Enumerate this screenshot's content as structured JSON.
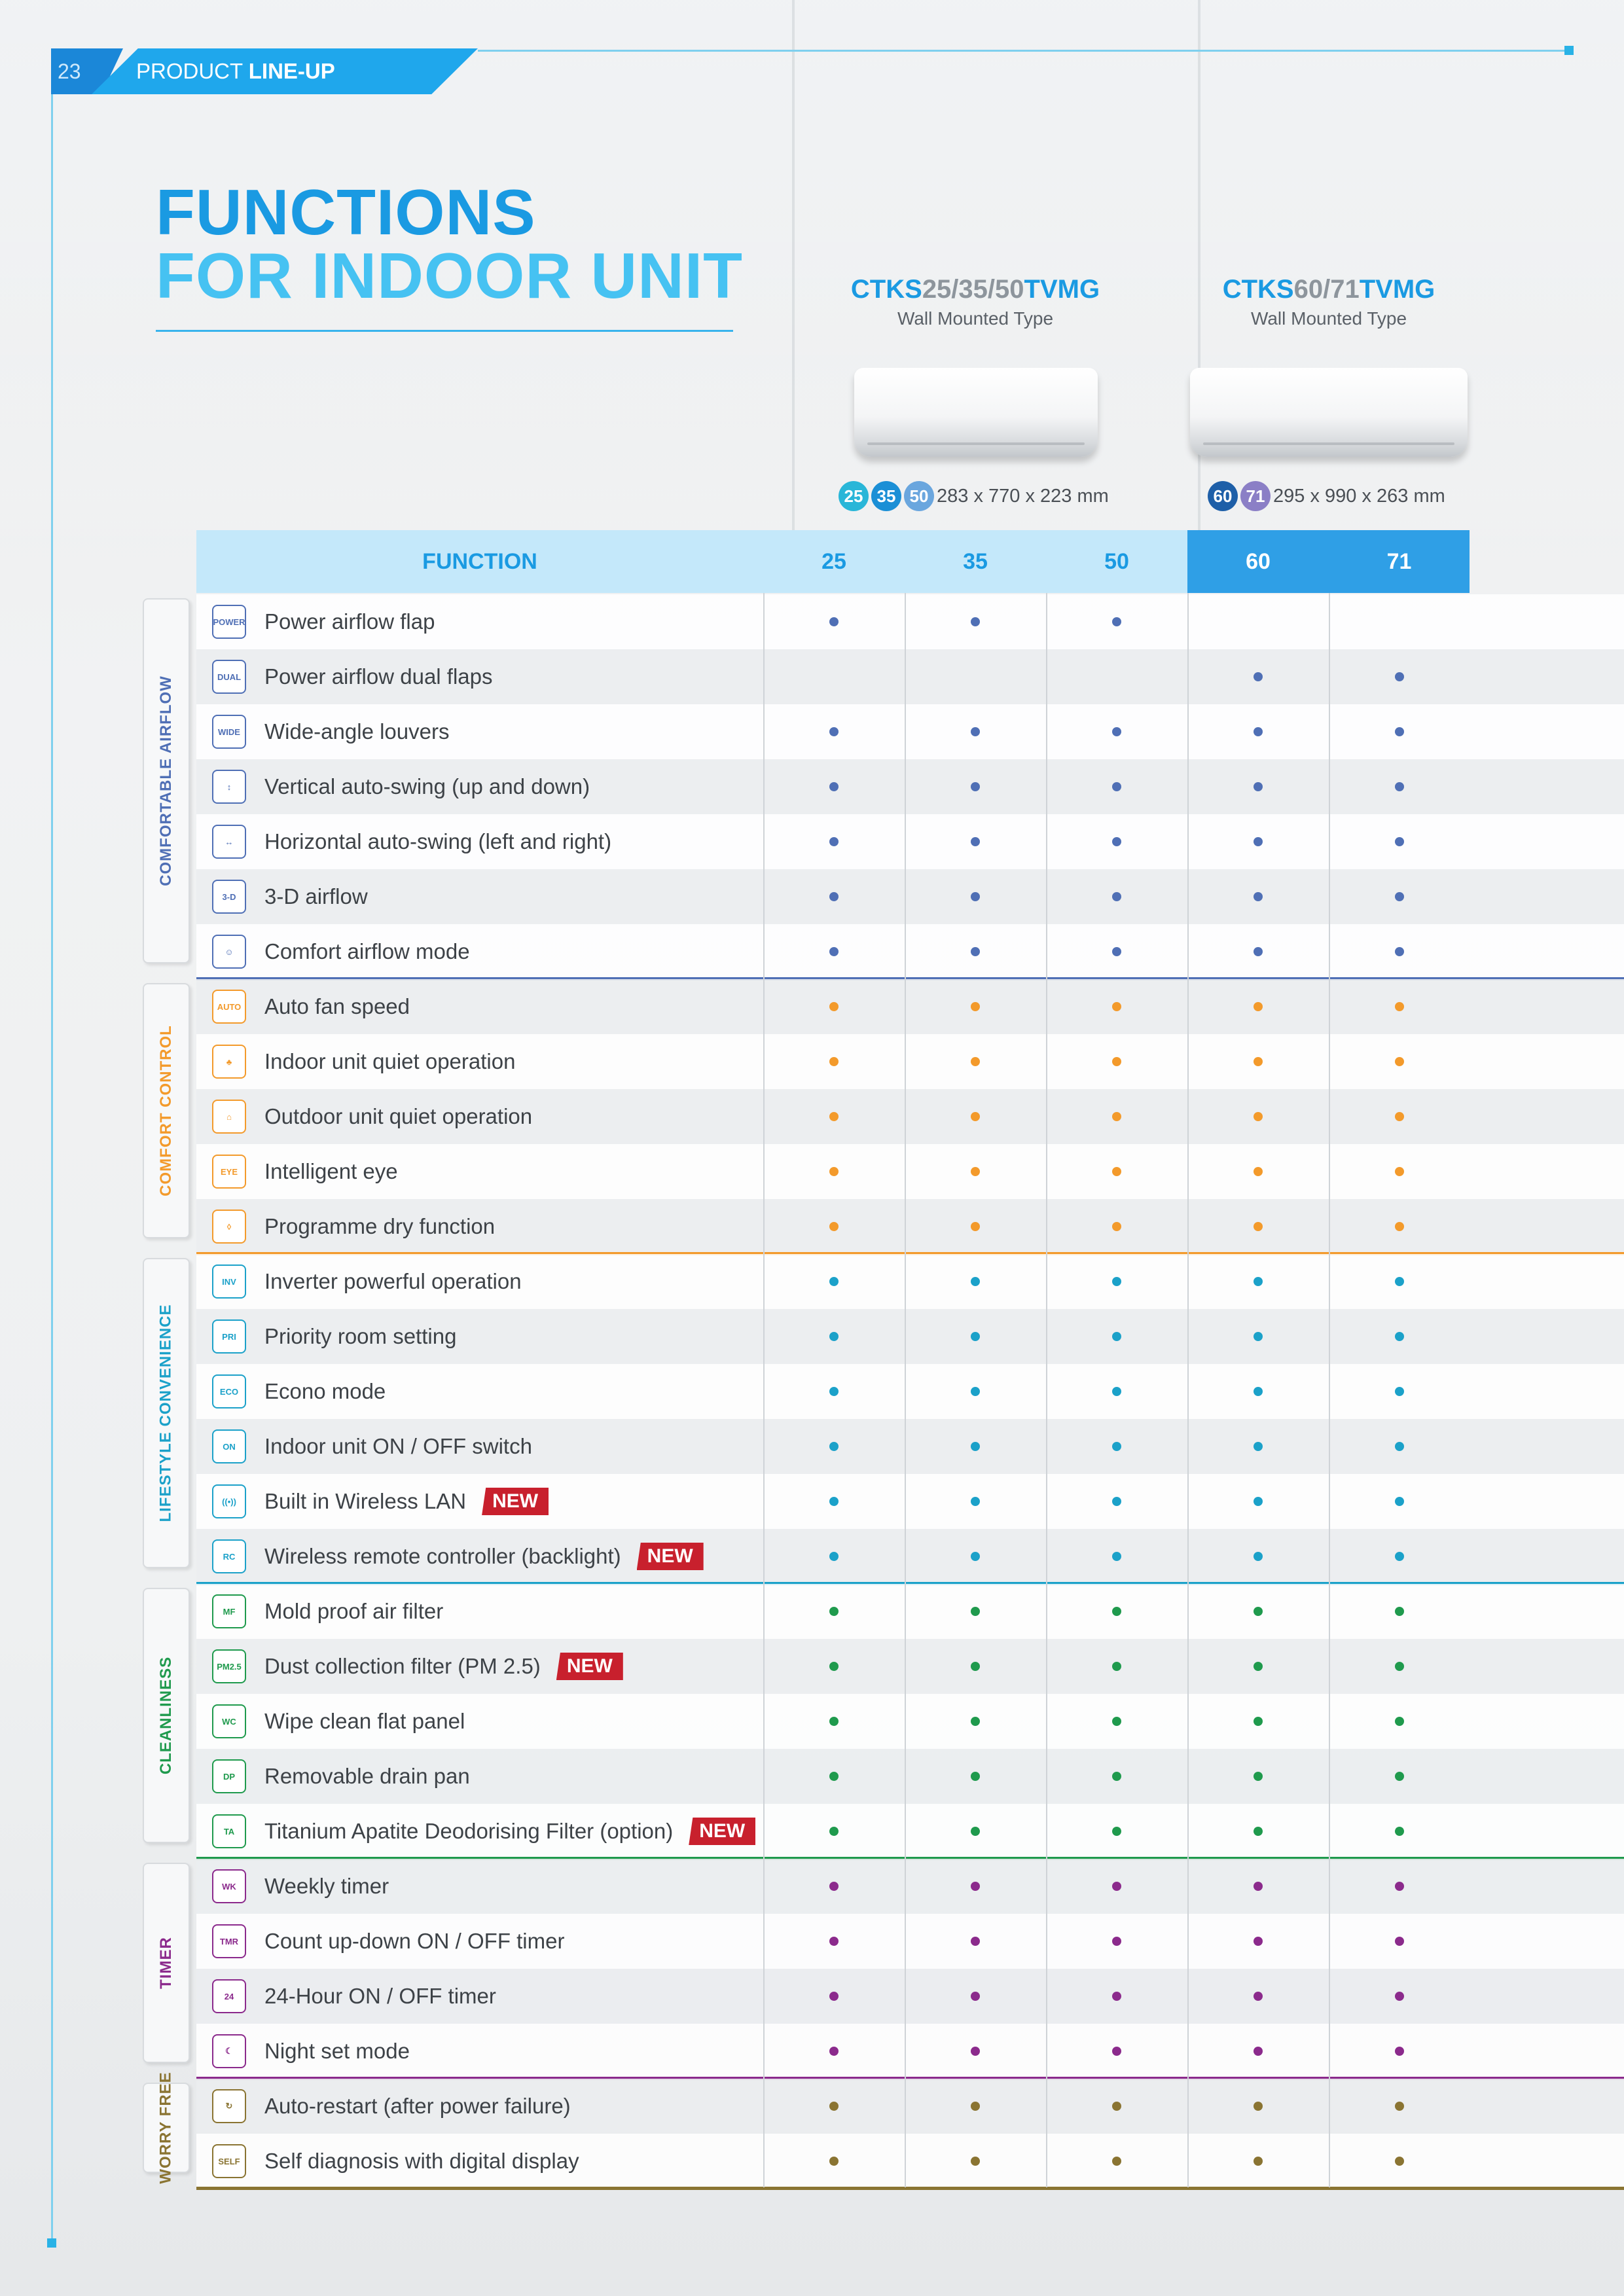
{
  "header": {
    "page_number": "23",
    "section_plain": "PRODUCT ",
    "section_bold": "LINE-UP"
  },
  "title": {
    "line1": "FUNCTIONS",
    "line2": "FOR INDOOR UNIT"
  },
  "models": [
    {
      "prefix": "CTKS",
      "sizes": "25/35/50",
      "suffix": "TVMG",
      "type": "Wall Mounted Type",
      "capacities": [
        "25",
        "35",
        "50"
      ],
      "capacity_colors": [
        "#29b6d8",
        "#1b8fd6",
        "#6aa6de"
      ],
      "dimensions": "283 x 770 x 223 mm"
    },
    {
      "prefix": "CTKS",
      "sizes": "60/71",
      "suffix": "TVMG",
      "type": "Wall Mounted Type",
      "capacities": [
        "60",
        "71"
      ],
      "capacity_colors": [
        "#1e5fa8",
        "#8b7fc6"
      ],
      "dimensions": "295 x 990 x 263 mm"
    }
  ],
  "table": {
    "function_header": "FUNCTION",
    "columns": [
      "25",
      "35",
      "50",
      "60",
      "71"
    ],
    "new_label": "NEW",
    "categories": [
      {
        "name": "COMFORTABLE AIRFLOW",
        "color": "#4f6fb5",
        "rows": [
          {
            "label": "Power airflow flap",
            "icon": "POWER",
            "dots": [
              true,
              true,
              true,
              false,
              false
            ]
          },
          {
            "label": "Power airflow dual flaps",
            "icon": "DUAL",
            "dots": [
              false,
              false,
              false,
              true,
              true
            ]
          },
          {
            "label": "Wide-angle louvers",
            "icon": "WIDE",
            "dots": [
              true,
              true,
              true,
              true,
              true
            ]
          },
          {
            "label": "Vertical auto-swing (up and down)",
            "icon": "↕",
            "dots": [
              true,
              true,
              true,
              true,
              true
            ]
          },
          {
            "label": "Horizontal auto-swing (left and right)",
            "icon": "↔",
            "dots": [
              true,
              true,
              true,
              true,
              true
            ]
          },
          {
            "label": "3-D airflow",
            "icon": "3-D",
            "dots": [
              true,
              true,
              true,
              true,
              true
            ]
          },
          {
            "label": "Comfort airflow mode",
            "icon": "☺",
            "dots": [
              true,
              true,
              true,
              true,
              true
            ]
          }
        ]
      },
      {
        "name": "COMFORT CONTROL",
        "color": "#f39a2b",
        "rows": [
          {
            "label": "Auto fan speed",
            "icon": "AUTO",
            "dots": [
              true,
              true,
              true,
              true,
              true
            ]
          },
          {
            "label": "Indoor unit quiet operation",
            "icon": "♣",
            "dots": [
              true,
              true,
              true,
              true,
              true
            ]
          },
          {
            "label": "Outdoor unit quiet operation",
            "icon": "⌂",
            "dots": [
              true,
              true,
              true,
              true,
              true
            ]
          },
          {
            "label": "Intelligent eye",
            "icon": "EYE",
            "dots": [
              true,
              true,
              true,
              true,
              true
            ]
          },
          {
            "label": "Programme dry function",
            "icon": "◊",
            "dots": [
              true,
              true,
              true,
              true,
              true
            ]
          }
        ]
      },
      {
        "name": "LIFESTYLE CONVENIENCE",
        "color": "#1ba1c9",
        "rows": [
          {
            "label": "Inverter powerful operation",
            "icon": "INV",
            "dots": [
              true,
              true,
              true,
              true,
              true
            ]
          },
          {
            "label": "Priority room setting",
            "icon": "PRI",
            "dots": [
              true,
              true,
              true,
              true,
              true
            ]
          },
          {
            "label": "Econo mode",
            "icon": "ECO",
            "dots": [
              true,
              true,
              true,
              true,
              true
            ]
          },
          {
            "label": "Indoor unit ON / OFF switch",
            "icon": "ON",
            "dots": [
              true,
              true,
              true,
              true,
              true
            ]
          },
          {
            "label": "Built in Wireless LAN",
            "icon": "((•))",
            "new": true,
            "dots": [
              true,
              true,
              true,
              true,
              true
            ]
          },
          {
            "label": "Wireless remote controller (backlight)",
            "icon": "RC",
            "new": true,
            "dots": [
              true,
              true,
              true,
              true,
              true
            ]
          }
        ]
      },
      {
        "name": "CLEANLINESS",
        "color": "#1f9a4d",
        "rows": [
          {
            "label": "Mold proof air filter",
            "icon": "MF",
            "dots": [
              true,
              true,
              true,
              true,
              true
            ]
          },
          {
            "label": "Dust collection filter (PM 2.5)",
            "icon": "PM2.5",
            "new": true,
            "dots": [
              true,
              true,
              true,
              true,
              true
            ]
          },
          {
            "label": "Wipe clean flat panel",
            "icon": "WC",
            "dots": [
              true,
              true,
              true,
              true,
              true
            ]
          },
          {
            "label": "Removable drain pan",
            "icon": "DP",
            "dots": [
              true,
              true,
              true,
              true,
              true
            ]
          },
          {
            "label": "Titanium Apatite Deodorising  Filter (option)",
            "icon": "TA",
            "new": true,
            "dots": [
              true,
              true,
              true,
              true,
              true
            ]
          }
        ]
      },
      {
        "name": "TIMER",
        "color": "#8b2a8c",
        "rows": [
          {
            "label": "Weekly timer",
            "icon": "WK",
            "dots": [
              true,
              true,
              true,
              true,
              true
            ]
          },
          {
            "label": "Count up-down ON / OFF timer",
            "icon": "TMR",
            "dots": [
              true,
              true,
              true,
              true,
              true
            ]
          },
          {
            "label": "24-Hour ON / OFF timer",
            "icon": "24",
            "dots": [
              true,
              true,
              true,
              true,
              true
            ]
          },
          {
            "label": "Night set mode",
            "icon": "☾",
            "dots": [
              true,
              true,
              true,
              true,
              true
            ]
          }
        ]
      },
      {
        "name": "WORRY FREE",
        "color": "#8a7432",
        "rows": [
          {
            "label": "Auto-restart (after power failure)",
            "icon": "↻",
            "dots": [
              true,
              true,
              true,
              true,
              true
            ]
          },
          {
            "label": "Self diagnosis with digital display",
            "icon": "SELF",
            "dots": [
              true,
              true,
              true,
              true,
              true
            ]
          }
        ]
      }
    ]
  }
}
